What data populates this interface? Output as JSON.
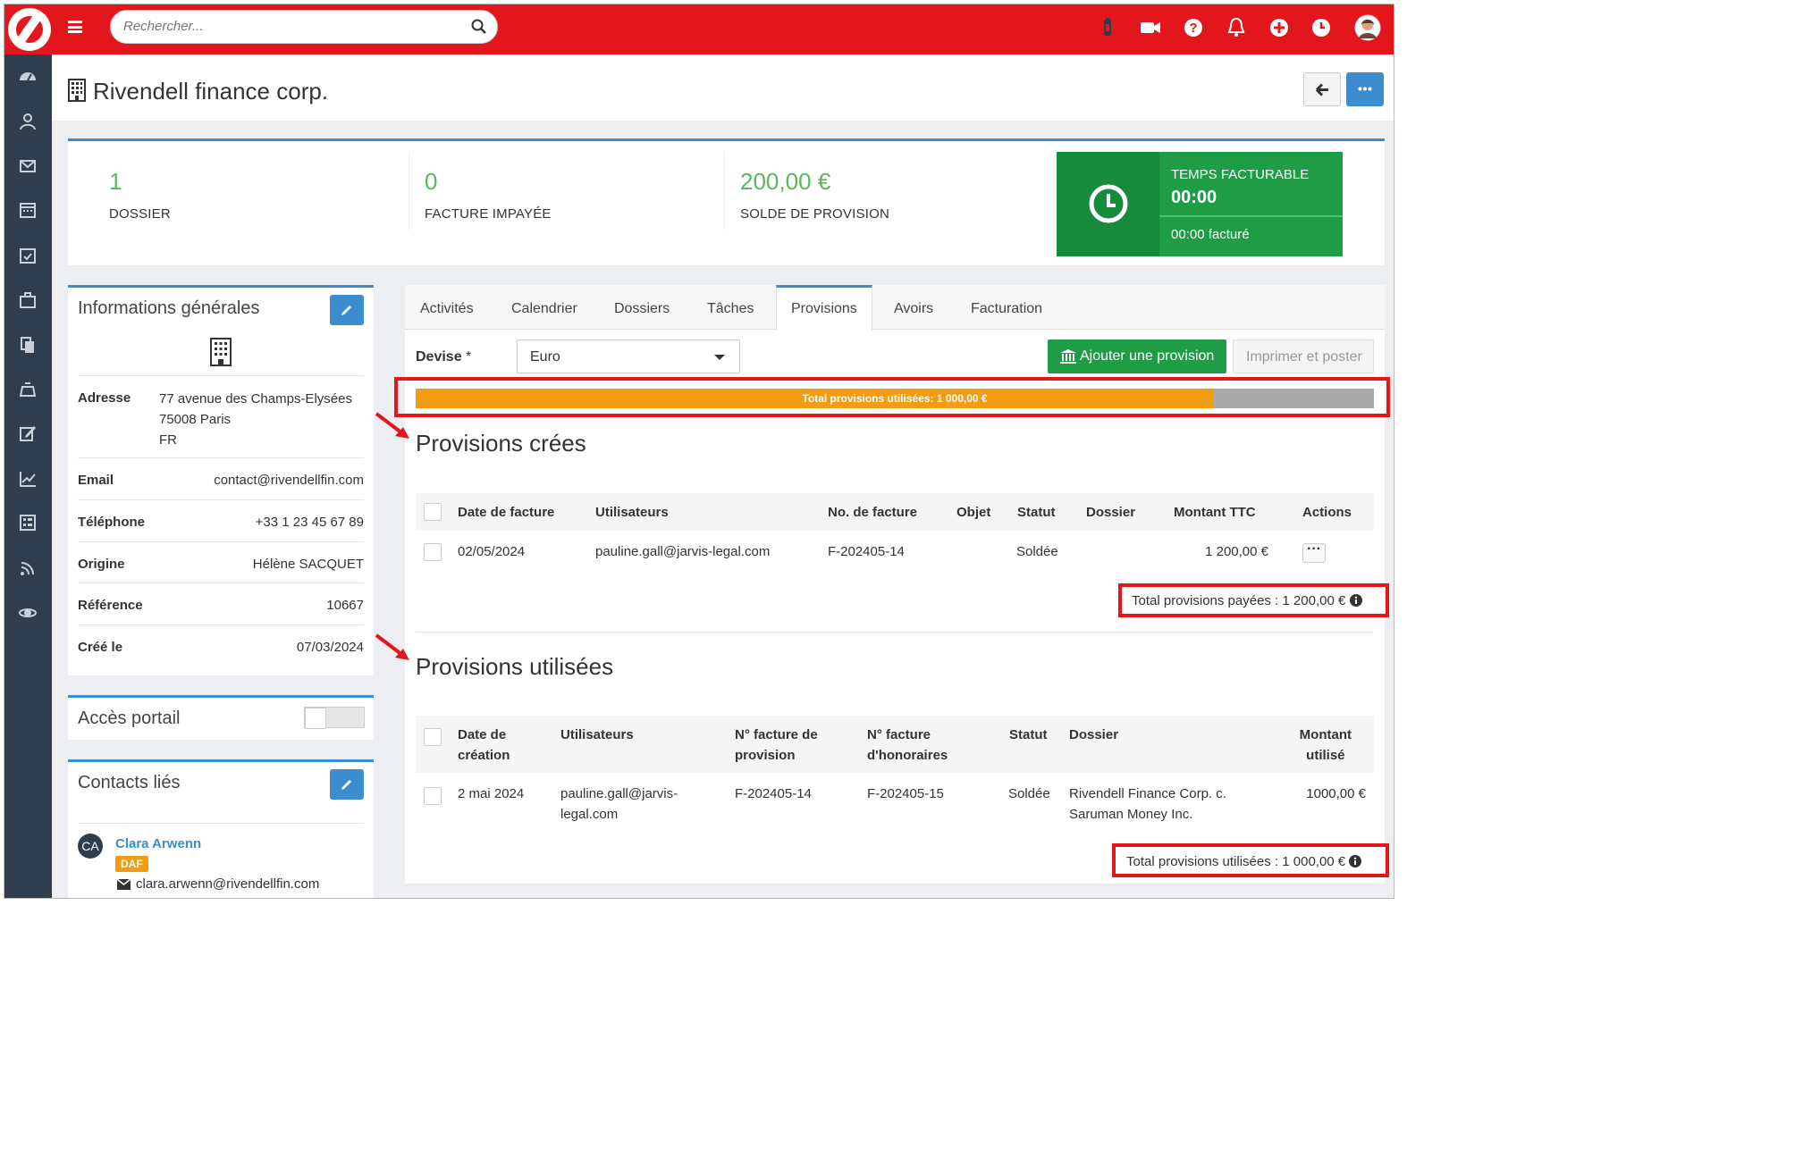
{
  "search": {
    "placeholder": "Rechercher..."
  },
  "page": {
    "title": "Rivendell finance corp."
  },
  "stats": [
    {
      "value": "1",
      "label": "DOSSIER"
    },
    {
      "value": "0",
      "label": "FACTURE IMPAYÉE"
    },
    {
      "value": "200,00 €",
      "label": "SOLDE DE PROVISION"
    }
  ],
  "time": {
    "title": "TEMPS FACTURABLE",
    "value": "00:00",
    "billed": "00:00 facturé"
  },
  "info": {
    "title": "Informations générales",
    "address_label": "Adresse",
    "address_line1": "77 avenue des Champs-Elysées",
    "address_line2": "75008 Paris",
    "address_line3": "FR",
    "email_label": "Email",
    "email": "contact@rivendellfin.com",
    "phone_label": "Téléphone",
    "phone": "+33 1 23 45 67 89",
    "origin_label": "Origine",
    "origin": "Hélène SACQUET",
    "ref_label": "Référence",
    "ref": "10667",
    "created_label": "Créé le",
    "created": "07/03/2024"
  },
  "portal": {
    "title": "Accès portail"
  },
  "contacts": {
    "title": "Contacts liés",
    "initials": "CA",
    "name": "Clara Arwenn",
    "role": "DAF",
    "email": "clara.arwenn@rivendellfin.com"
  },
  "tabs": [
    "Activités",
    "Calendrier",
    "Dossiers",
    "Tâches",
    "Provisions",
    "Avoirs",
    "Facturation"
  ],
  "devise": {
    "label": "Devise",
    "required": "*",
    "value": "Euro"
  },
  "buttons": {
    "add": "Ajouter une provision",
    "print": "Imprimer et poster"
  },
  "progress": {
    "label": "Total provisions utilisées: 1 000,00 €",
    "fraction": 0.833
  },
  "created": {
    "title": "Provisions crées",
    "headers": [
      "Date de facture",
      "Utilisateurs",
      "No. de facture",
      "Objet",
      "Statut",
      "Dossier",
      "Montant TTC",
      "Actions"
    ],
    "rows": [
      {
        "date": "02/05/2024",
        "user": "pauline.gall@jarvis-legal.com",
        "invoice": "F-202405-14",
        "object": "",
        "status": "Soldée",
        "dossier": "",
        "amount": "1 200,00 €"
      }
    ],
    "total": "Total provisions payées : 1 200,00 €"
  },
  "used": {
    "title": "Provisions utilisées",
    "h_date_1": "Date de",
    "h_date_2": "création",
    "h_users": "Utilisateurs",
    "h_prov_1": "N° facture de",
    "h_prov_2": "provision",
    "h_fee_1": "N° facture",
    "h_fee_2": "d'honoraires",
    "h_status": "Statut",
    "h_dossier": "Dossier",
    "h_amount_1": "Montant",
    "h_amount_2": "utilisé",
    "rows": [
      {
        "date": "2 mai 2024",
        "user_1": "pauline.gall@jarvis-",
        "user_2": "legal.com",
        "prov": "F-202405-14",
        "fee": "F-202405-15",
        "status": "Soldée",
        "dossier_1": "Rivendell Finance Corp. c.",
        "dossier_2": "Saruman Money Inc.",
        "amount": "1000,00 €"
      }
    ],
    "total": "Total provisions utilisées : 1 000,00 €"
  },
  "colors": {
    "brand": "#e3161d",
    "primary": "#3c8dcf",
    "success": "#1e9c46",
    "warning": "#f39c12",
    "sidebar": "#2f3e4e"
  }
}
